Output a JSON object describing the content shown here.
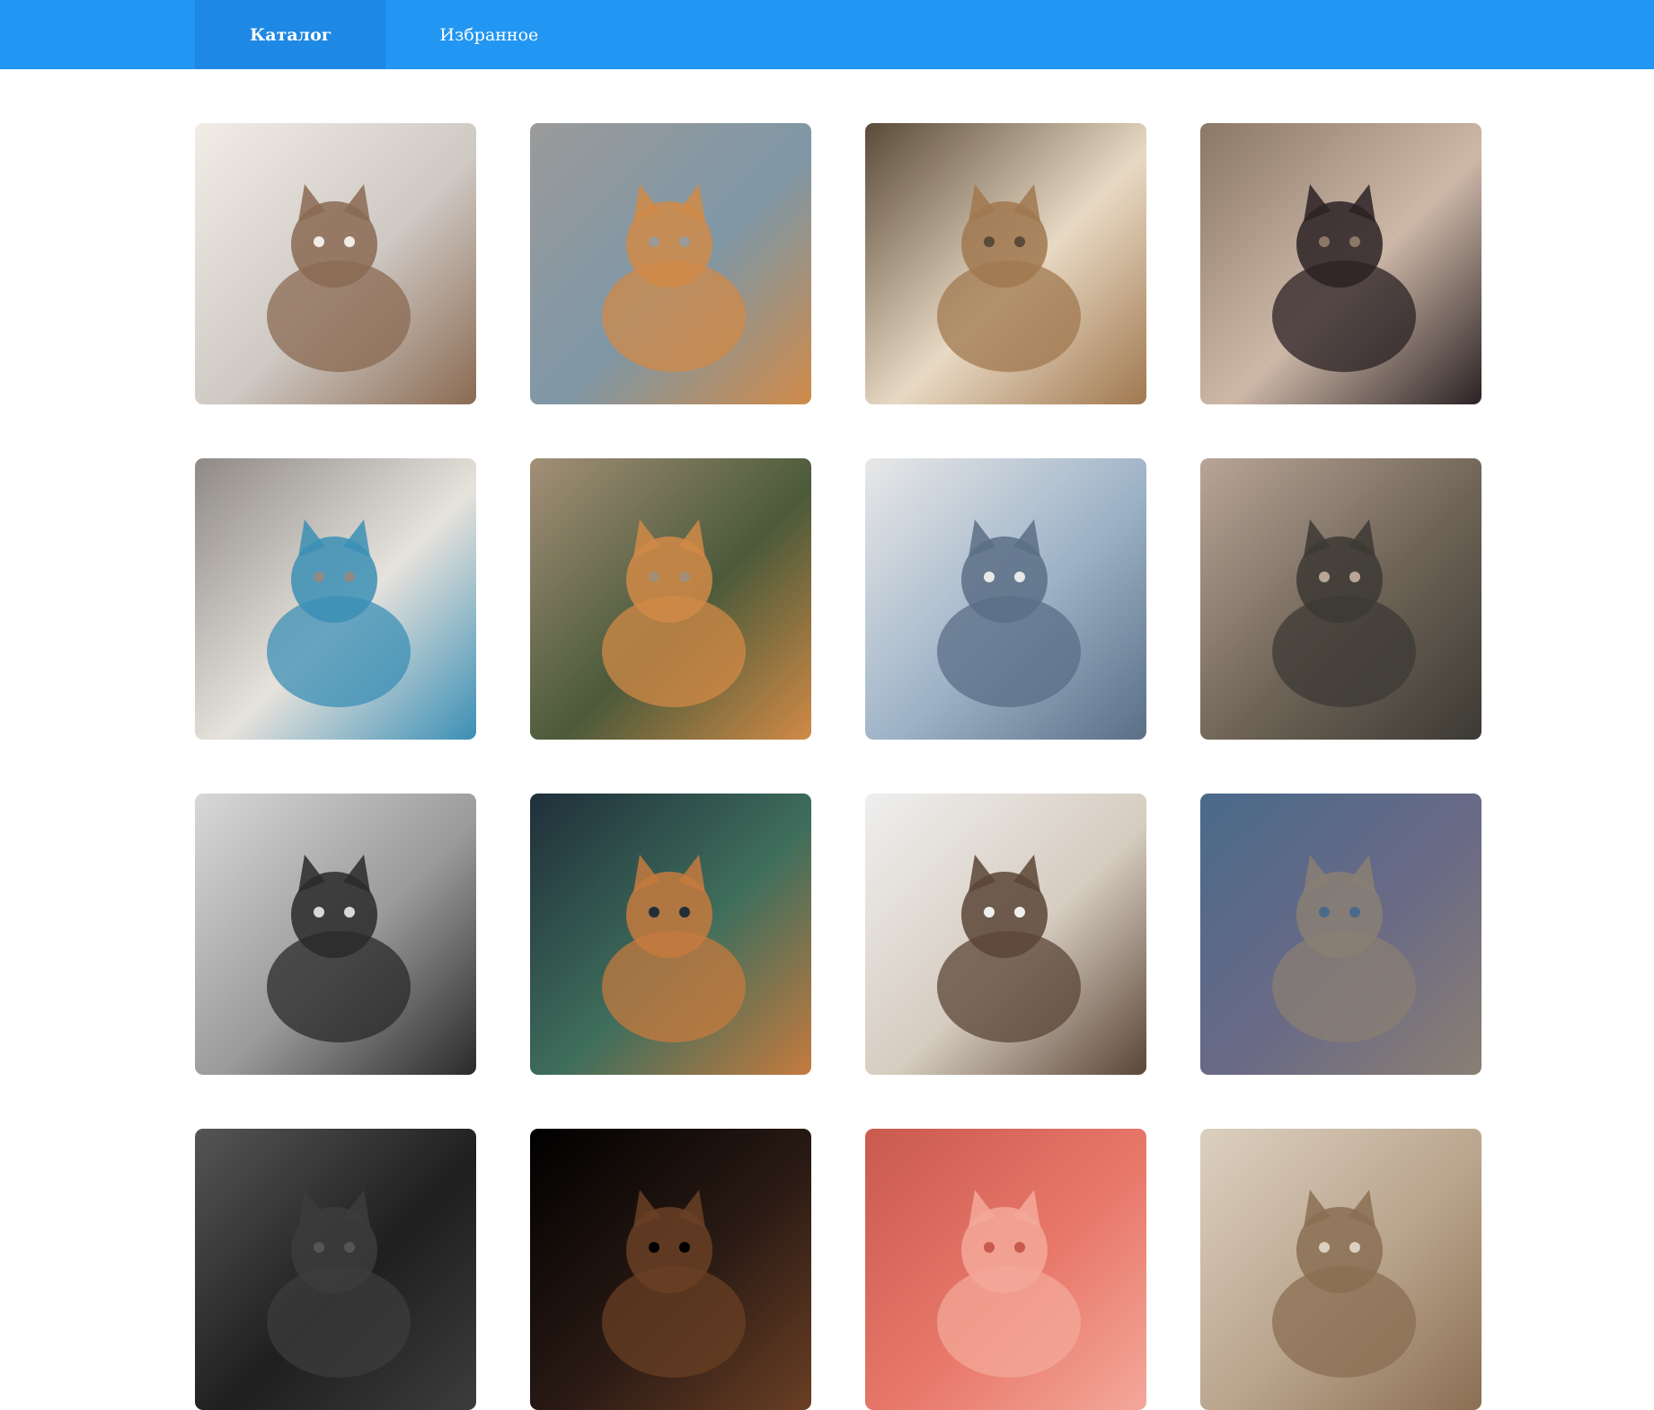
{
  "nav": {
    "items": [
      {
        "label": "Каталог",
        "active": true
      },
      {
        "label": "Избранное",
        "active": false
      }
    ]
  },
  "colors": {
    "header": "#2196f3",
    "header_active_tab": "#1e88e5",
    "background": "#ffffff"
  },
  "catalog": {
    "items": [
      {
        "photo": "cat-in-white-bag",
        "palette": [
          "#cfc9c4",
          "#8a6a52",
          "#f1ece6"
        ]
      },
      {
        "photo": "kittens-pile",
        "palette": [
          "#7f97a6",
          "#d08a48",
          "#9a9a9a"
        ]
      },
      {
        "photo": "cat-hugging-plush-toy",
        "palette": [
          "#e8d9c4",
          "#a0784f",
          "#5a4a38"
        ]
      },
      {
        "photo": "cat-in-bathroom-sink",
        "palette": [
          "#cdb8a8",
          "#2b2224",
          "#8c7866"
        ]
      },
      {
        "photo": "cat-in-party-hat",
        "palette": [
          "#e6e2dc",
          "#3b8fb5",
          "#8f8a86"
        ]
      },
      {
        "photo": "cat-with-fish-basket",
        "palette": [
          "#4b5a3a",
          "#d18a46",
          "#a38f77"
        ]
      },
      {
        "photo": "cat-and-lion-statue",
        "palette": [
          "#9db2c7",
          "#5a6e86",
          "#e8e8e8"
        ]
      },
      {
        "photo": "tabby-cat-closeup",
        "palette": [
          "#6e6356",
          "#3c3a34",
          "#b8a597"
        ]
      },
      {
        "photo": "cat-among-pigeons",
        "palette": [
          "#9a9a9a",
          "#2a2a2a",
          "#d8d8d8"
        ]
      },
      {
        "photo": "singing-cat-disco-ball",
        "palette": [
          "#3f6e5c",
          "#c57a3e",
          "#1f2f3a"
        ]
      },
      {
        "photo": "cat-lying-in-basket",
        "palette": [
          "#d6ccc0",
          "#5a4536",
          "#efefef"
        ]
      },
      {
        "photo": "kitten-in-hoodie-pocket",
        "palette": [
          "#6a6a86",
          "#8a7f73",
          "#4a6a8a"
        ]
      },
      {
        "photo": "dark-photo-1",
        "palette": [
          "#1f1f1f",
          "#3c3c3c",
          "#555555"
        ]
      },
      {
        "photo": "dark-photo-2",
        "palette": [
          "#2a1a14",
          "#6a3f24",
          "#000000"
        ]
      },
      {
        "photo": "pink-photo",
        "palette": [
          "#e8786a",
          "#f3a89a",
          "#c95a4e"
        ]
      },
      {
        "photo": "floral-photo",
        "palette": [
          "#b9a48c",
          "#8a6e52",
          "#dcd0c0"
        ]
      }
    ]
  }
}
